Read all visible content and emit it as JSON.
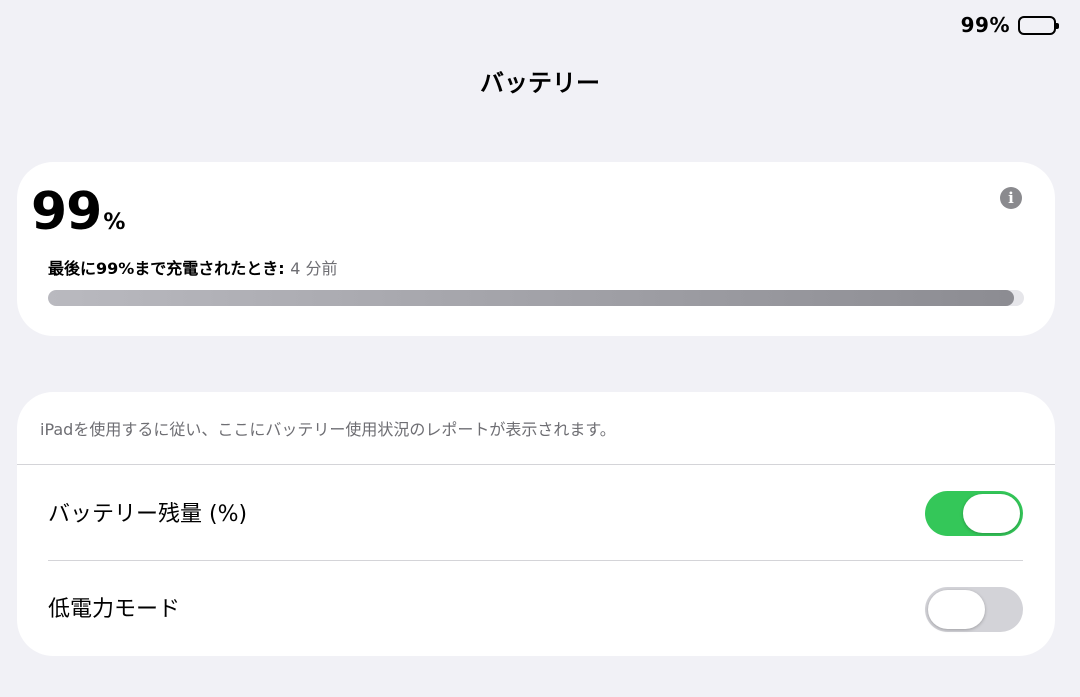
{
  "status_bar": {
    "battery_percent_label": "99%",
    "battery_level": 0.99
  },
  "page": {
    "title": "バッテリー"
  },
  "battery_level_card": {
    "value": "99",
    "unit": "%",
    "last_charged_label": "最後に99%まで充電されたとき:",
    "last_charged_ago": "4 分前",
    "level_fraction": 0.99,
    "info_icon": "info-icon"
  },
  "usage_card": {
    "note": "iPadを使用するに従い、ここにバッテリー使用状況のレポートが表示されます。",
    "rows": [
      {
        "label": "バッテリー残量 (%)",
        "toggle_on": true
      },
      {
        "label": "低電力モード",
        "toggle_on": false
      }
    ]
  },
  "colors": {
    "toggle_on": "#34c759",
    "toggle_off": "#d3d3d8",
    "background": "#f1f1f6",
    "card": "#ffffff"
  }
}
